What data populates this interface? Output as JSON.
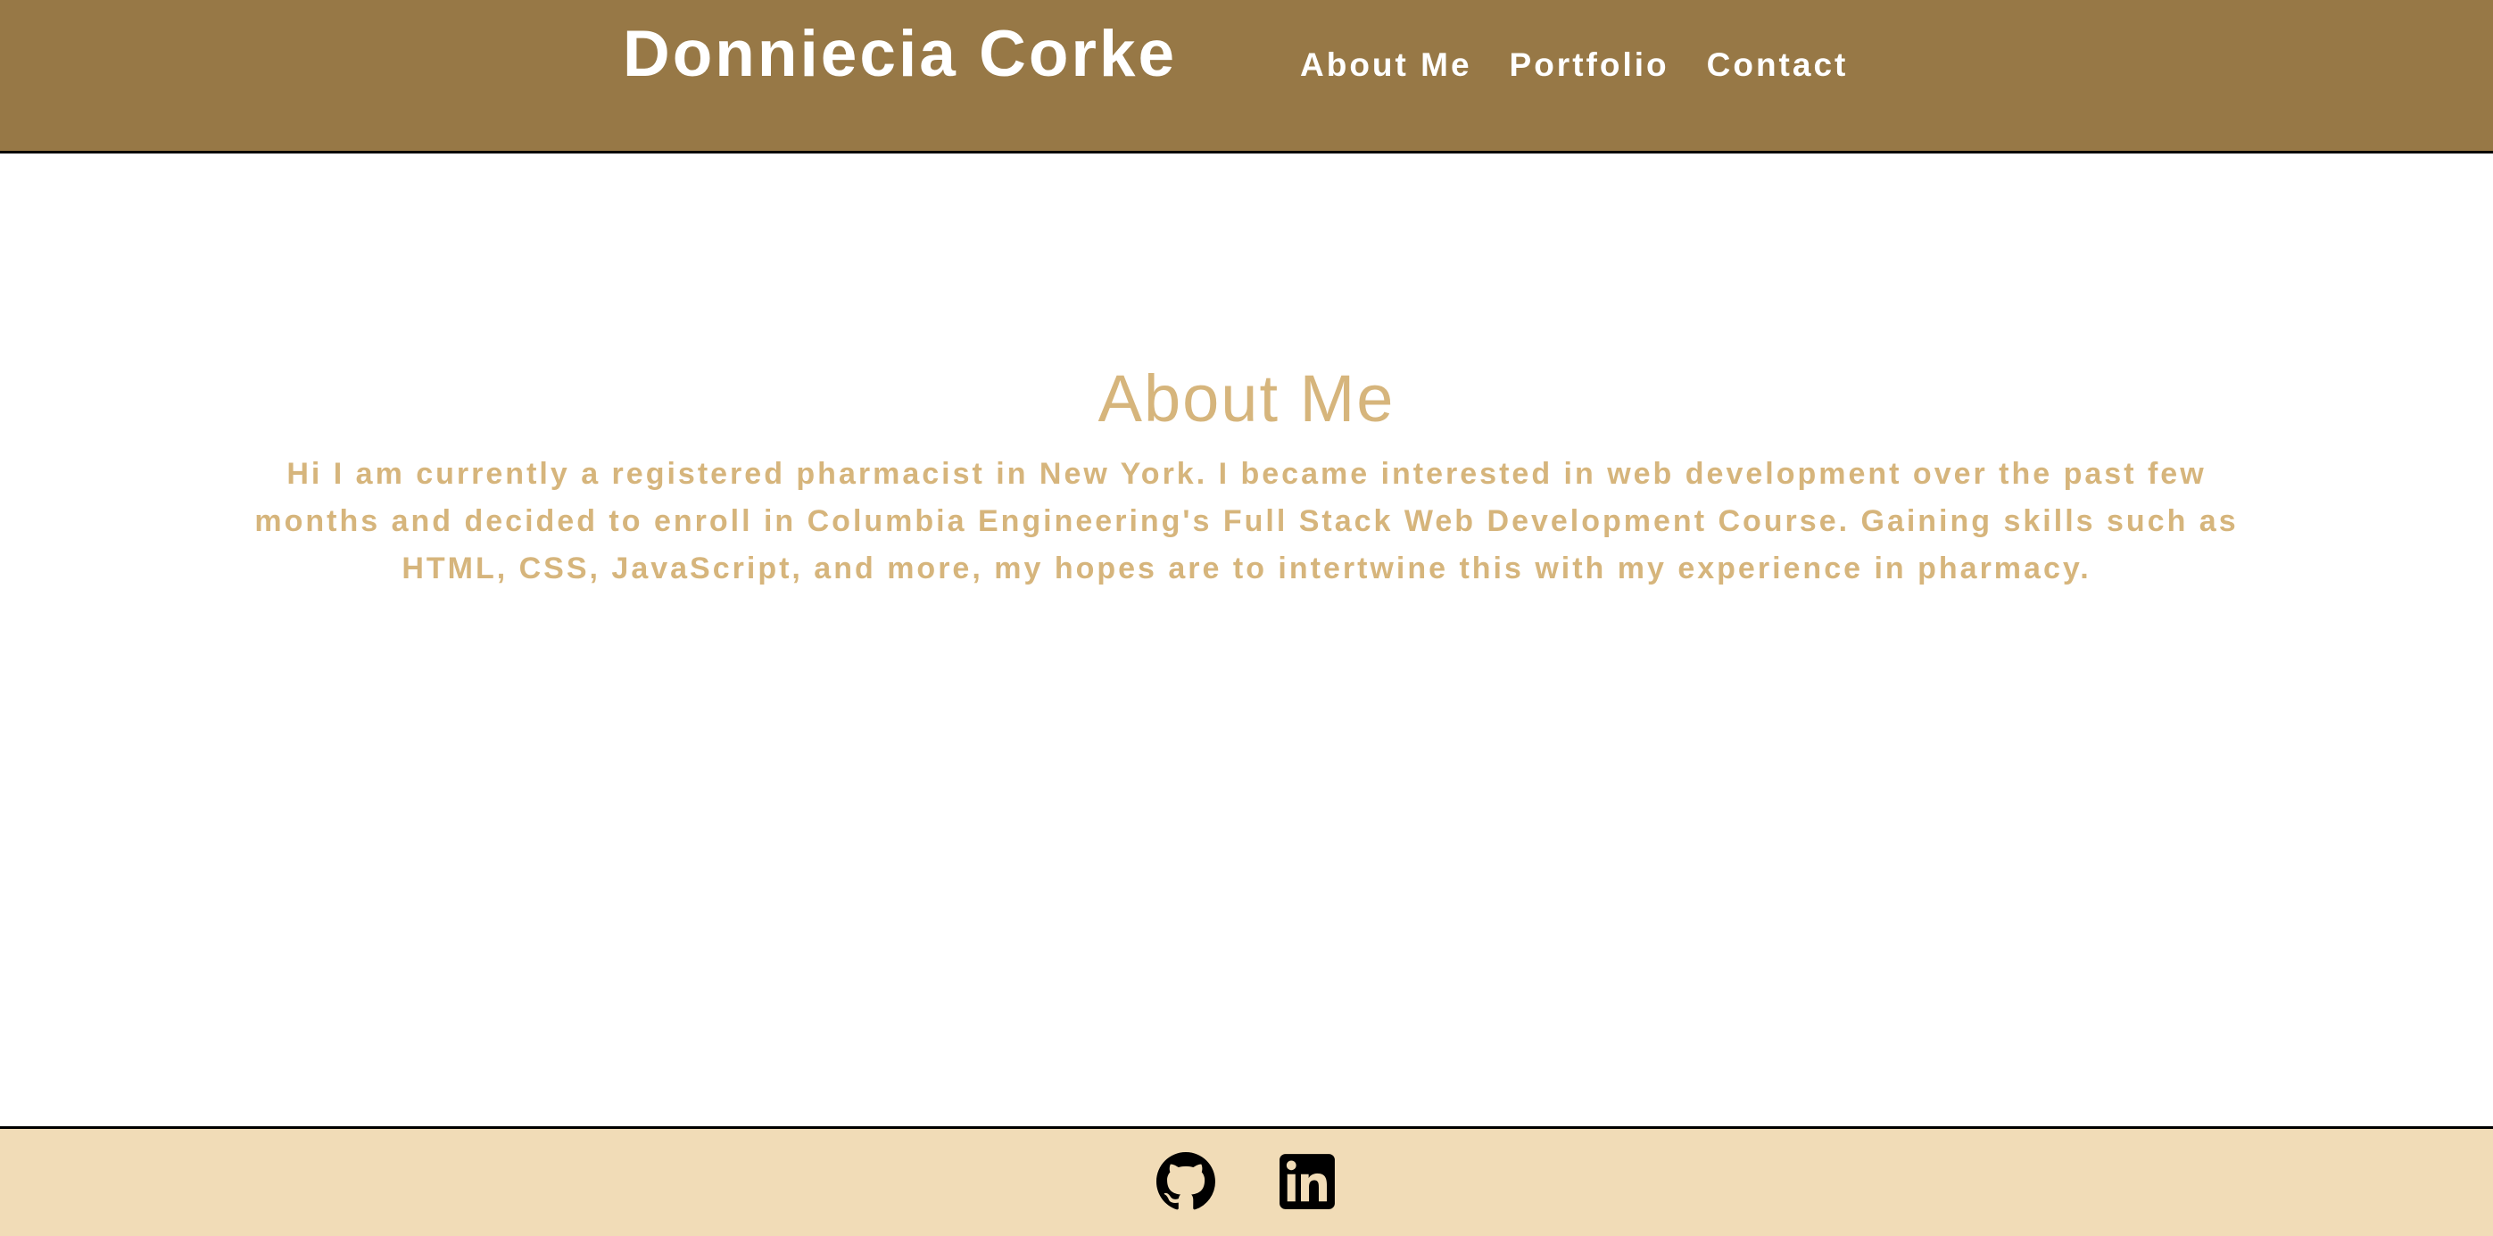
{
  "header": {
    "title": "Donniecia Corke",
    "nav": [
      {
        "label": "About Me"
      },
      {
        "label": "Portfolio"
      },
      {
        "label": "Contact"
      }
    ],
    "background_color": "#977846"
  },
  "main": {
    "heading": "About Me",
    "paragraph": "Hi I am currently a registered pharmacist in New York. I became interested in web development over the past few months and decided to enroll in Columbia Engineering's Full Stack Web Development Course. Gaining skills such as HTML, CSS, JavaScript, and more, my hopes are to intertwine this with my experience in pharmacy.",
    "text_color": "#d6b57c"
  },
  "footer": {
    "background_color": "#f1dcb7",
    "icons": [
      {
        "icon": "github-icon"
      },
      {
        "icon": "linkedin-icon"
      }
    ]
  }
}
